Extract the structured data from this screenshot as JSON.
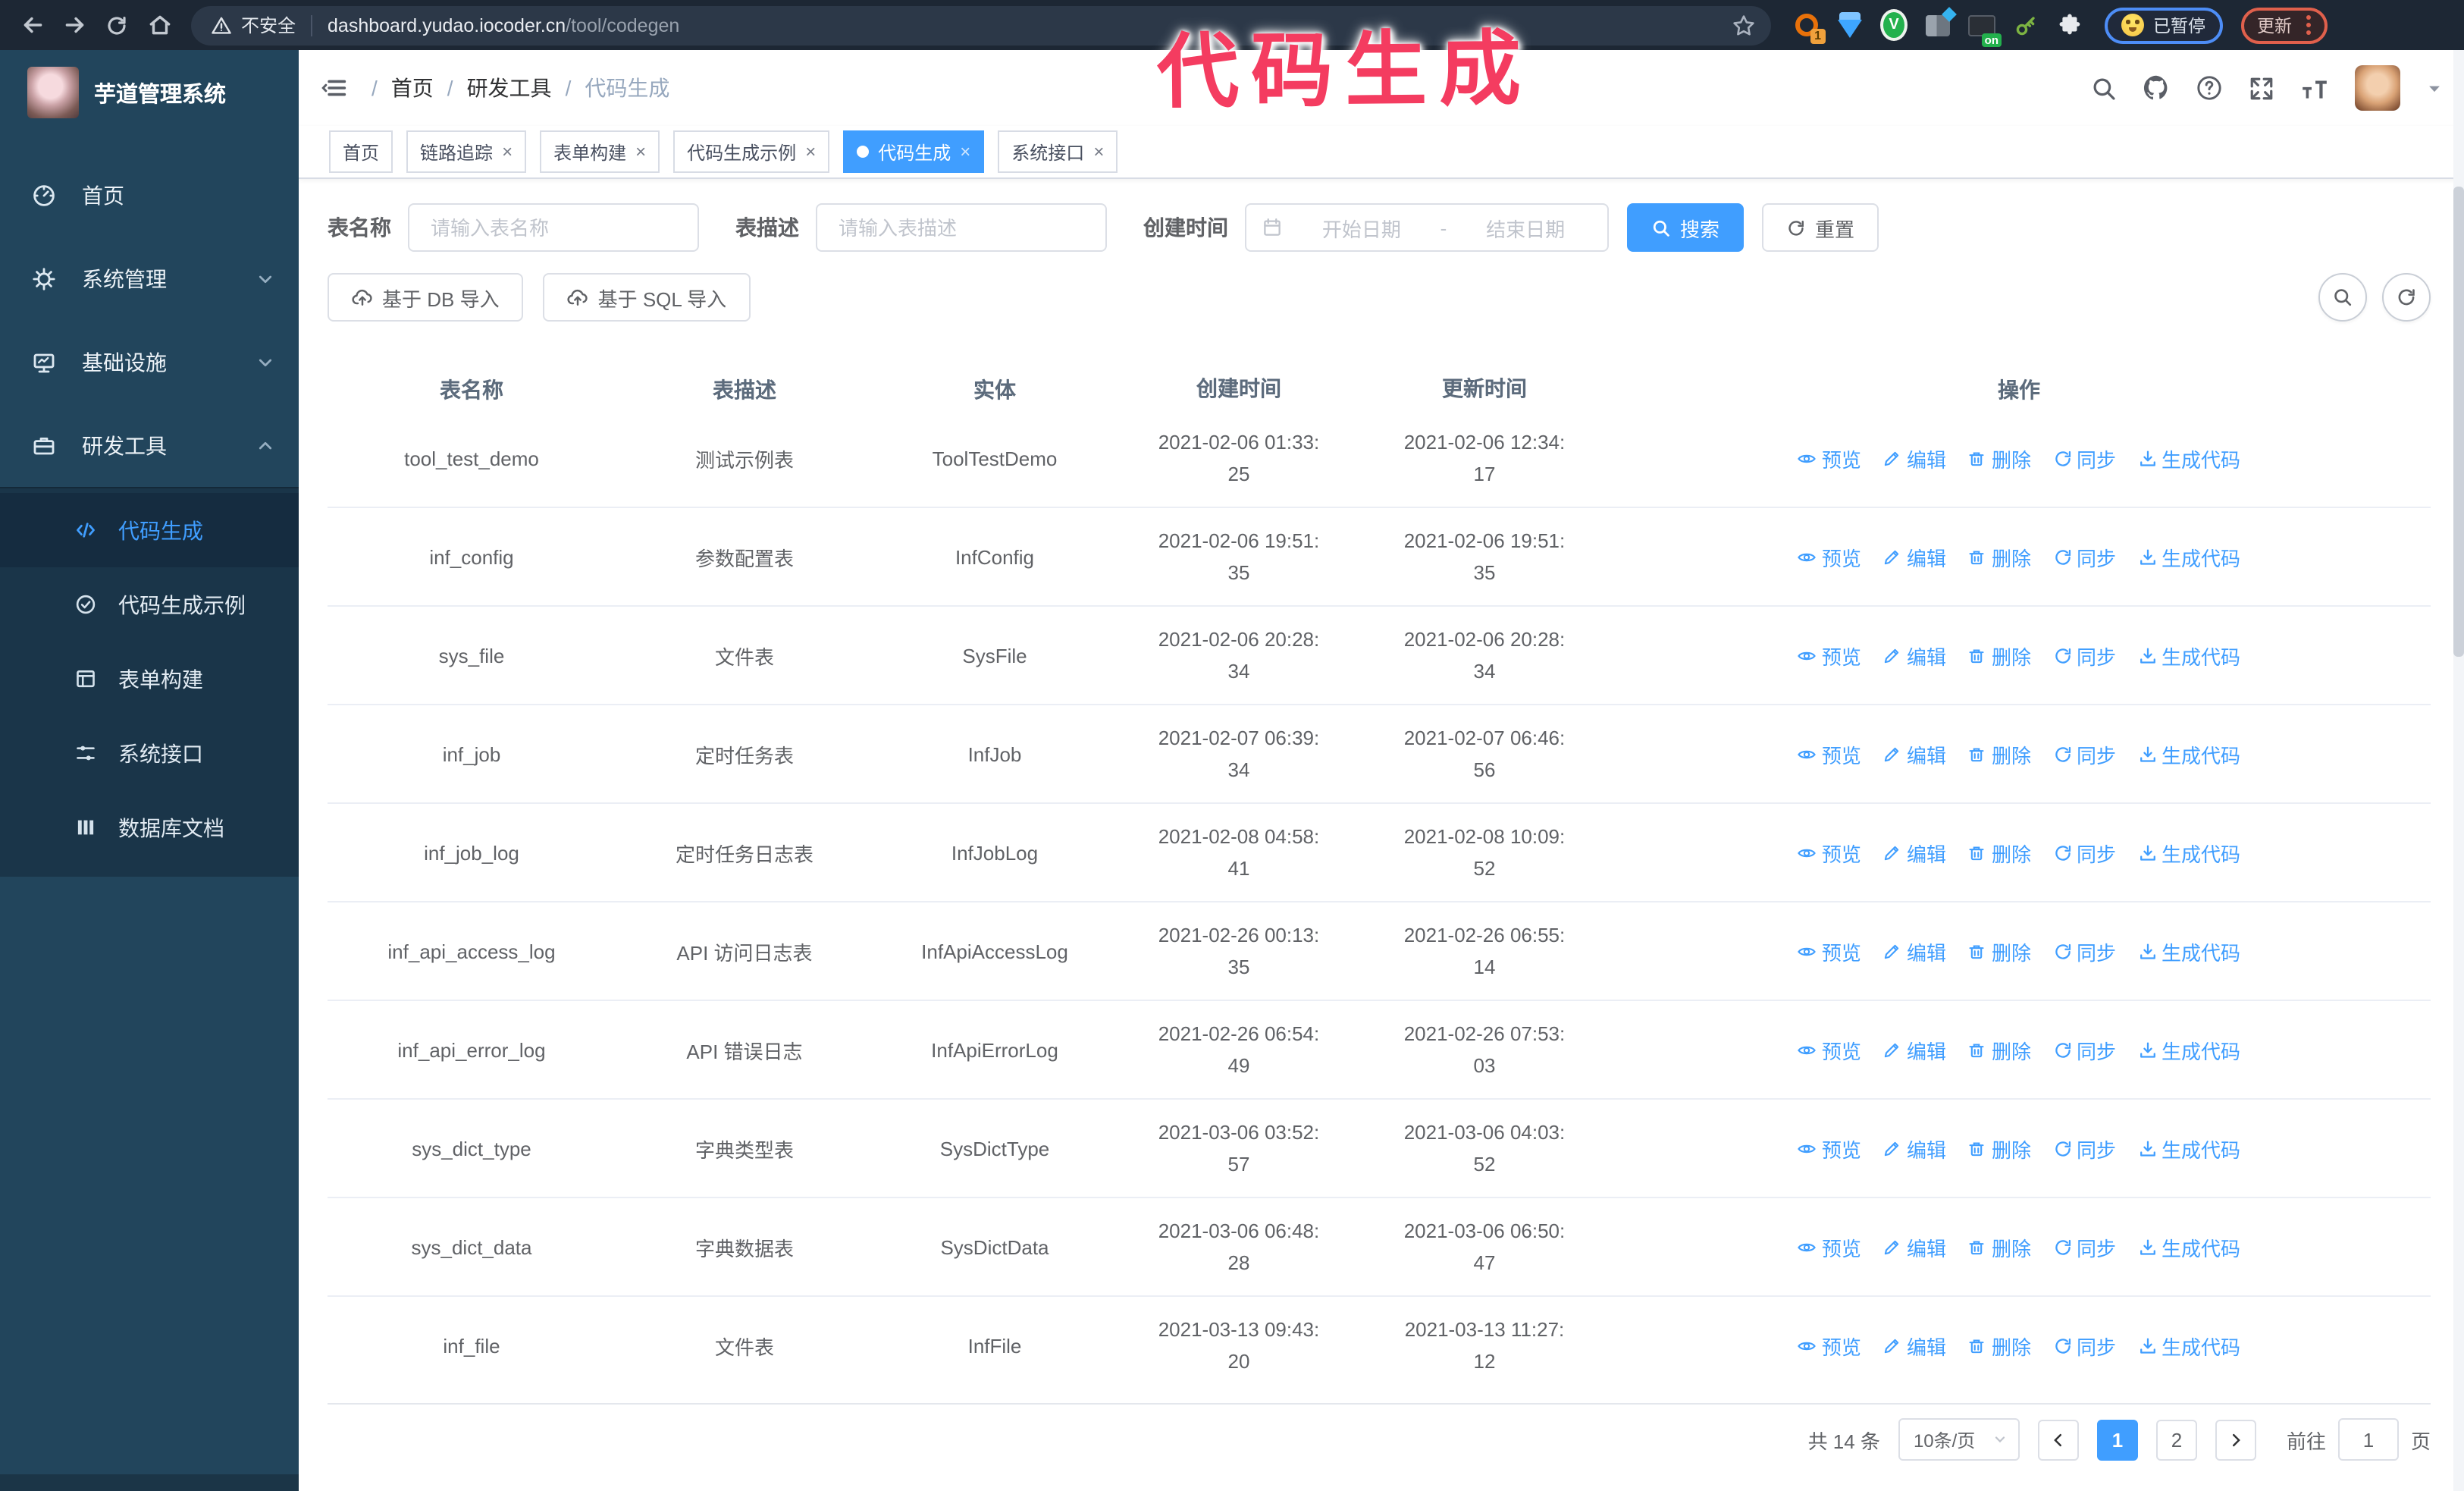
{
  "theme": {
    "primary": "#409eff",
    "sidebar": "#22455c",
    "submenu": "#1a3549",
    "annotation": "#f43c60",
    "browser_bar": "#1d2734"
  },
  "annotation": {
    "text": "代码生成"
  },
  "browser": {
    "security_warning": "不安全",
    "url_host": "dashboard.yudao.iocoder.cn",
    "url_path": "/tool/codegen",
    "extension_badge": "1",
    "extension_on_badge": "on",
    "paused_badge": "已暂停",
    "update_button": "更新"
  },
  "sidebar": {
    "title": "芋道管理系统",
    "menu": [
      {
        "label": "首页",
        "icon": "dashboard-icon"
      },
      {
        "label": "系统管理",
        "icon": "gear-icon",
        "chevron": "down"
      },
      {
        "label": "基础设施",
        "icon": "monitor-icon",
        "chevron": "down"
      },
      {
        "label": "研发工具",
        "icon": "toolbox-icon",
        "chevron": "up"
      }
    ],
    "submenu": [
      {
        "label": "代码生成",
        "icon": "code-icon",
        "active": true
      },
      {
        "label": "代码生成示例",
        "icon": "demo-badge-icon"
      },
      {
        "label": "表单构建",
        "icon": "form-icon"
      },
      {
        "label": "系统接口",
        "icon": "sliders-icon"
      },
      {
        "label": "数据库文档",
        "icon": "database-icon"
      }
    ]
  },
  "breadcrumb": {
    "separator": "/",
    "items": [
      {
        "label": "首页"
      },
      {
        "label": "研发工具"
      },
      {
        "label": "代码生成",
        "active": true
      }
    ]
  },
  "tabs": [
    {
      "label": "首页",
      "closable": false
    },
    {
      "label": "链路追踪"
    },
    {
      "label": "表单构建"
    },
    {
      "label": "代码生成示例"
    },
    {
      "label": "代码生成",
      "active": true
    },
    {
      "label": "系统接口"
    }
  ],
  "filters": {
    "table_name_label": "表名称",
    "table_name_placeholder": "请输入表名称",
    "table_desc_label": "表描述",
    "table_desc_placeholder": "请输入表描述",
    "create_time_label": "创建时间",
    "date_start_placeholder": "开始日期",
    "date_separator": "-",
    "date_end_placeholder": "结束日期",
    "search_label": "搜索",
    "reset_label": "重置"
  },
  "toolbar": {
    "import_db_label": "基于 DB 导入",
    "import_sql_label": "基于 SQL 导入"
  },
  "table": {
    "columns": [
      "表名称",
      "表描述",
      "实体",
      "创建时间",
      "更新时间",
      "操作"
    ],
    "actions": [
      "预览",
      "编辑",
      "删除",
      "同步",
      "生成代码"
    ],
    "rows": [
      {
        "name": "tool_test_demo",
        "desc": "测试示例表",
        "entity": "ToolTestDemo",
        "created": "2021-02-06 01:33:25",
        "updated": "2021-02-06 12:34:17"
      },
      {
        "name": "inf_config",
        "desc": "参数配置表",
        "entity": "InfConfig",
        "created": "2021-02-06 19:51:35",
        "updated": "2021-02-06 19:51:35"
      },
      {
        "name": "sys_file",
        "desc": "文件表",
        "entity": "SysFile",
        "created": "2021-02-06 20:28:34",
        "updated": "2021-02-06 20:28:34"
      },
      {
        "name": "inf_job",
        "desc": "定时任务表",
        "entity": "InfJob",
        "created": "2021-02-07 06:39:34",
        "updated": "2021-02-07 06:46:56"
      },
      {
        "name": "inf_job_log",
        "desc": "定时任务日志表",
        "entity": "InfJobLog",
        "created": "2021-02-08 04:58:41",
        "updated": "2021-02-08 10:09:52"
      },
      {
        "name": "inf_api_access_log",
        "desc": "API 访问日志表",
        "entity": "InfApiAccessLog",
        "created": "2021-02-26 00:13:35",
        "updated": "2021-02-26 06:55:14"
      },
      {
        "name": "inf_api_error_log",
        "desc": "API 错误日志",
        "entity": "InfApiErrorLog",
        "created": "2021-02-26 06:54:49",
        "updated": "2021-02-26 07:53:03"
      },
      {
        "name": "sys_dict_type",
        "desc": "字典类型表",
        "entity": "SysDictType",
        "created": "2021-03-06 03:52:57",
        "updated": "2021-03-06 04:03:52"
      },
      {
        "name": "sys_dict_data",
        "desc": "字典数据表",
        "entity": "SysDictData",
        "created": "2021-03-06 06:48:28",
        "updated": "2021-03-06 06:50:47"
      },
      {
        "name": "inf_file",
        "desc": "文件表",
        "entity": "InfFile",
        "created": "2021-03-13 09:43:20",
        "updated": "2021-03-13 11:27:12"
      }
    ]
  },
  "pagination": {
    "total": "共 14 条",
    "page_size": "10条/页",
    "pages": [
      {
        "label": "1",
        "active": true
      },
      {
        "label": "2"
      }
    ],
    "goto_label": "前往",
    "goto_value": "1",
    "page_unit": "页"
  }
}
